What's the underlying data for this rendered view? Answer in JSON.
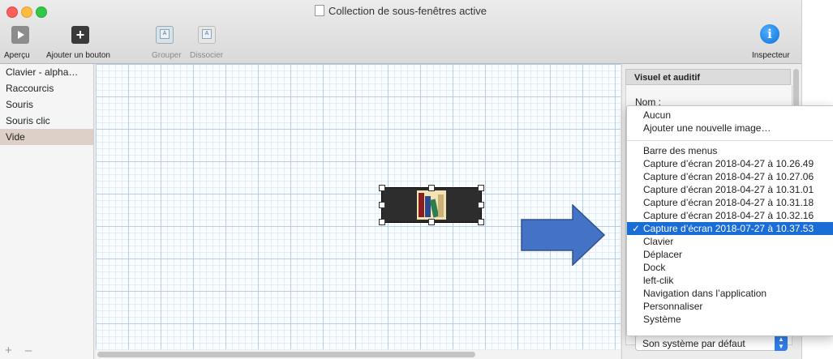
{
  "window": {
    "title": "Collection de sous-fenêtres active"
  },
  "toolbar": {
    "apercu": "Aperçu",
    "ajouter": "Ajouter un bouton",
    "grouper": "Grouper",
    "dissocier": "Dissocier",
    "inspecteur": "Inspecteur",
    "info_glyph": "i",
    "plus_glyph": "+"
  },
  "sidebar": {
    "items": [
      {
        "label": "Clavier - alpha…"
      },
      {
        "label": "Raccourcis"
      },
      {
        "label": "Souris"
      },
      {
        "label": "Souris clic"
      },
      {
        "label": "Vide"
      }
    ],
    "selected": "Vide",
    "footer": "+ –"
  },
  "inspector": {
    "section_title": "Visuel et auditif",
    "name_label": "Nom :",
    "sound_value": "Son système par défaut"
  },
  "dropdown": {
    "items": [
      "Aucun",
      "Ajouter une nouvelle image…",
      "Barre des menus",
      "Capture d’écran 2018-04-27 à 10.26.49",
      "Capture d’écran 2018-04-27 à 10.27.06",
      "Capture d’écran 2018-04-27 à 10.31.01",
      "Capture d’écran 2018-04-27 à 10.31.18",
      "Capture d’écran 2018-04-27 à 10.32.16",
      "Capture d’écran 2018-07-27 à 10.37.53",
      "Clavier",
      "Déplacer",
      "Dock",
      "left-clik",
      "Navigation dans l’application",
      "Personnaliser",
      "Système"
    ],
    "selected": "Capture d’écran 2018-07-27 à 10.37.53",
    "checkmark": "✓"
  },
  "colors": {
    "selection": "#1a6cd7",
    "arrow": "#4472c4",
    "sidebar_selected": "#dcd0c8"
  }
}
